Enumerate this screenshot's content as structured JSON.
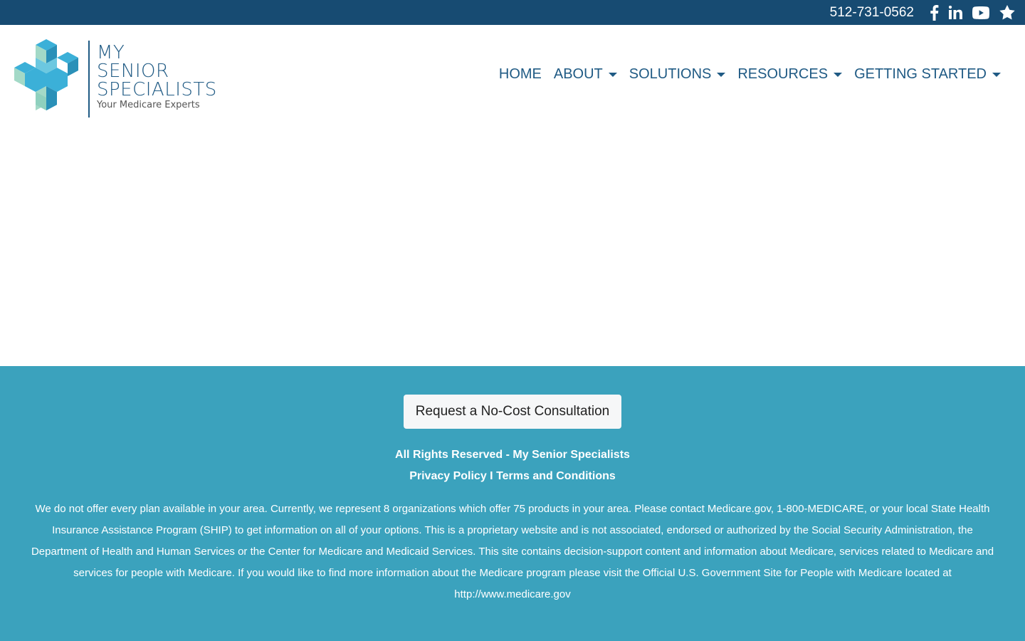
{
  "topbar": {
    "phone": "512-731-0562",
    "social": [
      "facebook-icon",
      "linkedin-icon",
      "youtube-icon",
      "star-icon"
    ]
  },
  "logo": {
    "line1": "MY",
    "line2": "SENIOR",
    "line3": "SPECIALISTS",
    "tagline": "Your Medicare Experts",
    "colors": {
      "brand": "#1f5a84",
      "cube_top": "#3bb0d8",
      "cube_side": "#2a90b8",
      "cube_left": "#a3d9c7"
    }
  },
  "nav": {
    "items": [
      {
        "label": "HOME",
        "dropdown": false
      },
      {
        "label": "ABOUT",
        "dropdown": true
      },
      {
        "label": "SOLUTIONS",
        "dropdown": true
      },
      {
        "label": "RESOURCES",
        "dropdown": true
      },
      {
        "label": "GETTING STARTED",
        "dropdown": true
      }
    ]
  },
  "footer": {
    "cta_label": "Request a No-Cost Consultation",
    "rights": "All Rights Reserved - My Senior Specialists",
    "privacy_label": "Privacy Policy",
    "separator": "I",
    "terms_label": "Terms and Conditions",
    "disclaimer": "We do not offer every plan available in your area. Currently, we represent 8 organizations which offer 75 products in your area. Please contact Medicare.gov, 1-800-MEDICARE, or your local State Health Insurance Assistance Program (SHIP) to get information on all of your options. This is a proprietary website and is not associated, endorsed or authorized by the Social Security Administration, the Department of Health and Human Services or the Center for Medicare and Medicaid Services. This site contains decision-support content and information about Medicare, services related to Medicare and services for people with Medicare. If you would like to find more information about the Medicare program please visit the Official U.S. Government Site for People with Medicare located at",
    "medicare_link": "http://www.medicare.gov"
  },
  "colors": {
    "topbar": "#174b72",
    "footer": "#3ba2bd",
    "nav_text": "#1f5a84"
  }
}
